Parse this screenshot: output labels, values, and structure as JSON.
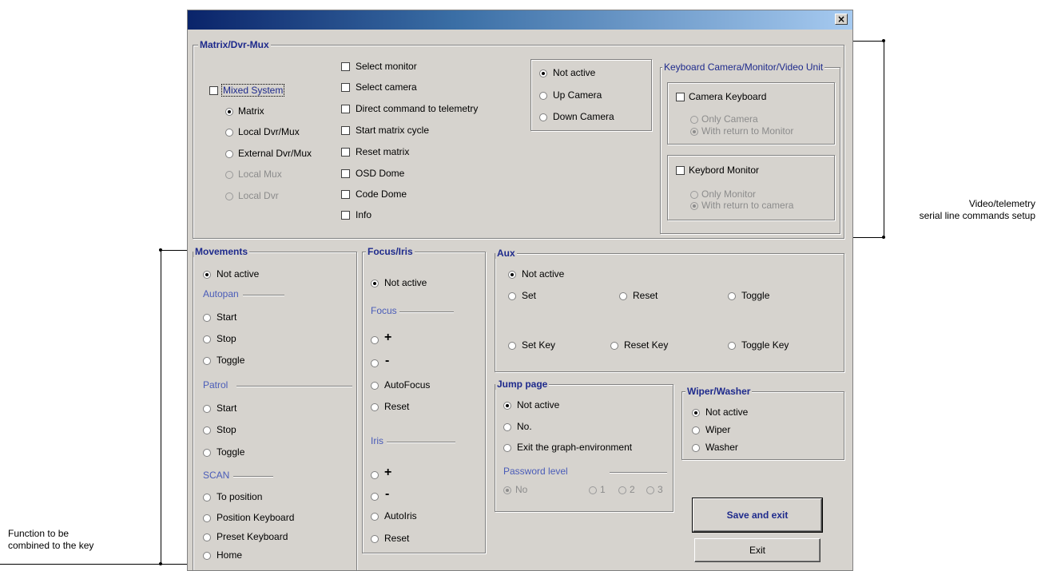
{
  "window": {
    "close_glyph": "×"
  },
  "matrix": {
    "title": "Matrix/Dvr-Mux",
    "mixed_system": "Mixed System",
    "mode_options": [
      "Matrix",
      "Local Dvr/Mux",
      "External Dvr/Mux",
      "Local Mux",
      "Local Dvr"
    ],
    "commands": [
      "Select monitor",
      "Select camera",
      "Direct command to telemetry",
      "Start matrix cycle",
      "Reset matrix",
      "OSD Dome",
      "Code Dome",
      "Info"
    ]
  },
  "camera_step": {
    "options": [
      "Not active",
      "Up Camera",
      "Down Camera"
    ]
  },
  "keyboard": {
    "title": "Keyboard Camera/Monitor/Video Unit",
    "camera_keyboard": "Camera Keyboard",
    "camera_options": [
      "Only Camera",
      "With return to Monitor"
    ],
    "monitor_keyboard": "Keybord Monitor",
    "monitor_options": [
      "Only Monitor",
      "With return to camera"
    ]
  },
  "movements": {
    "title": "Movements",
    "not_active": "Not active",
    "autopan_label": "Autopan",
    "autopan": [
      "Start",
      "Stop",
      "Toggle"
    ],
    "patrol_label": "Patrol",
    "patrol": [
      "Start",
      "Stop",
      "Toggle"
    ],
    "scan_label": "SCAN",
    "scan": [
      "To position",
      "Position Keyboard",
      "Preset Keyboard",
      "Home"
    ]
  },
  "focus_iris": {
    "title": "Focus/Iris",
    "not_active": "Not active",
    "focus_label": "Focus",
    "focus": [
      "+",
      "-",
      "AutoFocus",
      "Reset"
    ],
    "iris_label": "Iris",
    "iris": [
      "+",
      "-",
      "AutoIris",
      "Reset"
    ]
  },
  "aux": {
    "title": "Aux",
    "not_active": "Not active",
    "row1": [
      "Set",
      "Reset",
      "Toggle"
    ],
    "row2": [
      "Set Key",
      "Reset Key",
      "Toggle Key"
    ]
  },
  "jump_page": {
    "title": "Jump page",
    "options": [
      "Not active",
      "No.",
      "Exit the graph-environment"
    ],
    "password_label": "Password level",
    "password_options": [
      "No",
      "1",
      "2",
      "3"
    ]
  },
  "wiper": {
    "title": "Wiper/Washer",
    "options": [
      "Not active",
      "Wiper",
      "Washer"
    ]
  },
  "buttons": {
    "save_exit": "Save and exit",
    "exit": "Exit"
  },
  "annotations": {
    "right_line1": "Video/telemetry",
    "right_line2": "serial line commands setup",
    "left_line1": "Function to be",
    "left_line2": "combined to the key"
  }
}
